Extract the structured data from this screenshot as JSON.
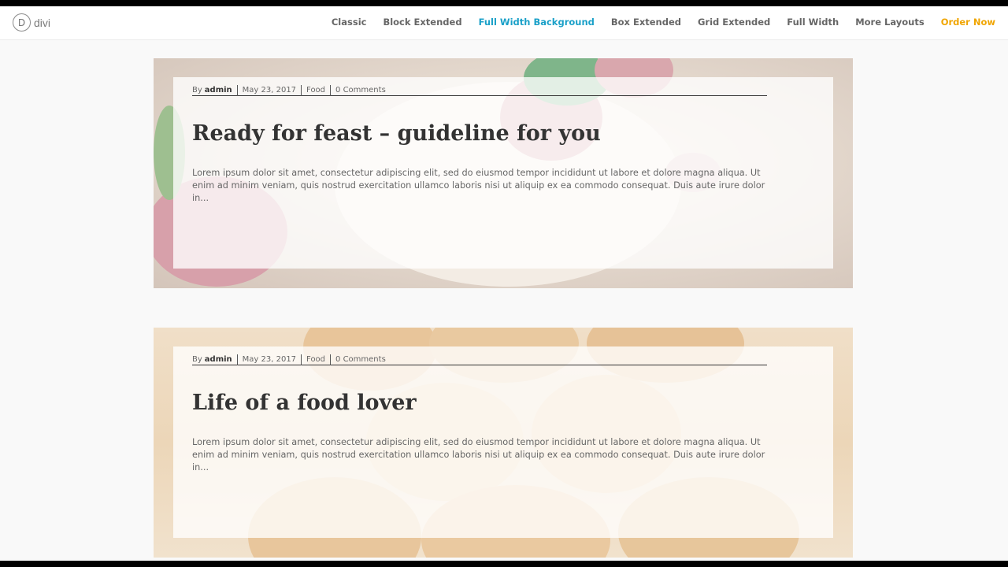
{
  "logo": {
    "glyph": "D",
    "text": "divi"
  },
  "nav": [
    {
      "label": "Classic"
    },
    {
      "label": "Block Extended"
    },
    {
      "label": "Full Width Background"
    },
    {
      "label": "Box Extended"
    },
    {
      "label": "Grid Extended"
    },
    {
      "label": "Full Width"
    },
    {
      "label": "More Layouts"
    },
    {
      "label": "Order Now"
    }
  ],
  "colors": {
    "active": "#1aa0c8",
    "cta": "#f0a500"
  },
  "posts": [
    {
      "by": "By",
      "author": "admin",
      "date": "May 23, 2017",
      "category": "Food",
      "comments": "0 Comments",
      "title": "Ready for feast – guideline for you",
      "excerpt": "Lorem ipsum dolor sit amet, consectetur adipiscing elit, sed do eiusmod tempor incididunt ut labore et dolore magna aliqua. Ut enim ad minim veniam, quis nostrud exercitation ullamco laboris nisi ut aliquip ex ea commodo consequat. Duis aute irure dolor in..."
    },
    {
      "by": "By",
      "author": "admin",
      "date": "May 23, 2017",
      "category": "Food",
      "comments": "0 Comments",
      "title": "Life of a food lover",
      "excerpt": "Lorem ipsum dolor sit amet, consectetur adipiscing elit, sed do eiusmod tempor incididunt ut labore et dolore magna aliqua. Ut enim ad minim veniam, quis nostrud exercitation ullamco laboris nisi ut aliquip ex ea commodo consequat. Duis aute irure dolor in..."
    }
  ]
}
